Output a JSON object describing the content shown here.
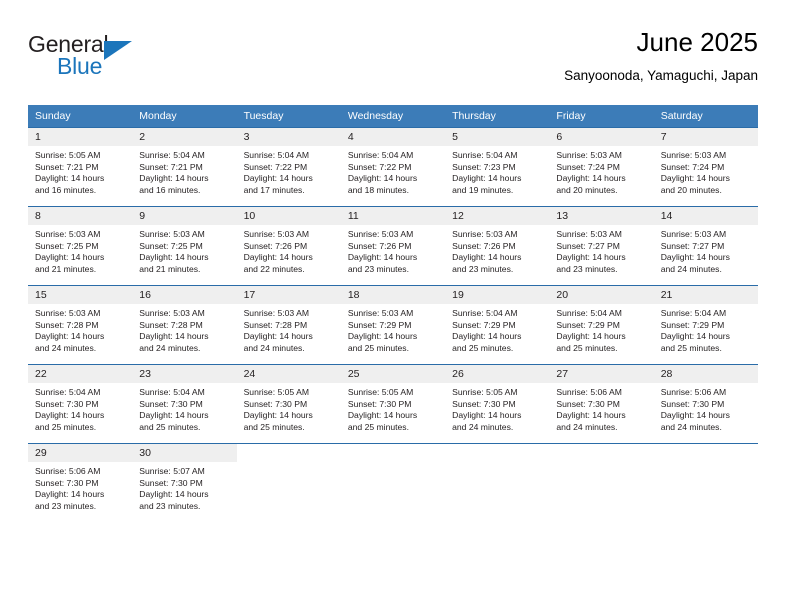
{
  "brand": {
    "name_top": "General",
    "name_bottom": "Blue",
    "color_dark": "#231f20",
    "color_blue": "#1b75bb",
    "triangle_icon": "triangle-icon"
  },
  "header": {
    "title": "June 2025",
    "subtitle": "Sanyoonoda, Yamaguchi, Japan"
  },
  "theme": {
    "header_bg": "#3c7cb8",
    "row_divider": "#2a6ca8",
    "daynum_bg": "#efefef"
  },
  "weekday_headers": [
    "Sunday",
    "Monday",
    "Tuesday",
    "Wednesday",
    "Thursday",
    "Friday",
    "Saturday"
  ],
  "weeks": [
    [
      {
        "day": "1",
        "sunrise": "Sunrise: 5:05 AM",
        "sunset": "Sunset: 7:21 PM",
        "daylight1": "Daylight: 14 hours",
        "daylight2": "and 16 minutes."
      },
      {
        "day": "2",
        "sunrise": "Sunrise: 5:04 AM",
        "sunset": "Sunset: 7:21 PM",
        "daylight1": "Daylight: 14 hours",
        "daylight2": "and 16 minutes."
      },
      {
        "day": "3",
        "sunrise": "Sunrise: 5:04 AM",
        "sunset": "Sunset: 7:22 PM",
        "daylight1": "Daylight: 14 hours",
        "daylight2": "and 17 minutes."
      },
      {
        "day": "4",
        "sunrise": "Sunrise: 5:04 AM",
        "sunset": "Sunset: 7:22 PM",
        "daylight1": "Daylight: 14 hours",
        "daylight2": "and 18 minutes."
      },
      {
        "day": "5",
        "sunrise": "Sunrise: 5:04 AM",
        "sunset": "Sunset: 7:23 PM",
        "daylight1": "Daylight: 14 hours",
        "daylight2": "and 19 minutes."
      },
      {
        "day": "6",
        "sunrise": "Sunrise: 5:03 AM",
        "sunset": "Sunset: 7:24 PM",
        "daylight1": "Daylight: 14 hours",
        "daylight2": "and 20 minutes."
      },
      {
        "day": "7",
        "sunrise": "Sunrise: 5:03 AM",
        "sunset": "Sunset: 7:24 PM",
        "daylight1": "Daylight: 14 hours",
        "daylight2": "and 20 minutes."
      }
    ],
    [
      {
        "day": "8",
        "sunrise": "Sunrise: 5:03 AM",
        "sunset": "Sunset: 7:25 PM",
        "daylight1": "Daylight: 14 hours",
        "daylight2": "and 21 minutes."
      },
      {
        "day": "9",
        "sunrise": "Sunrise: 5:03 AM",
        "sunset": "Sunset: 7:25 PM",
        "daylight1": "Daylight: 14 hours",
        "daylight2": "and 21 minutes."
      },
      {
        "day": "10",
        "sunrise": "Sunrise: 5:03 AM",
        "sunset": "Sunset: 7:26 PM",
        "daylight1": "Daylight: 14 hours",
        "daylight2": "and 22 minutes."
      },
      {
        "day": "11",
        "sunrise": "Sunrise: 5:03 AM",
        "sunset": "Sunset: 7:26 PM",
        "daylight1": "Daylight: 14 hours",
        "daylight2": "and 23 minutes."
      },
      {
        "day": "12",
        "sunrise": "Sunrise: 5:03 AM",
        "sunset": "Sunset: 7:26 PM",
        "daylight1": "Daylight: 14 hours",
        "daylight2": "and 23 minutes."
      },
      {
        "day": "13",
        "sunrise": "Sunrise: 5:03 AM",
        "sunset": "Sunset: 7:27 PM",
        "daylight1": "Daylight: 14 hours",
        "daylight2": "and 23 minutes."
      },
      {
        "day": "14",
        "sunrise": "Sunrise: 5:03 AM",
        "sunset": "Sunset: 7:27 PM",
        "daylight1": "Daylight: 14 hours",
        "daylight2": "and 24 minutes."
      }
    ],
    [
      {
        "day": "15",
        "sunrise": "Sunrise: 5:03 AM",
        "sunset": "Sunset: 7:28 PM",
        "daylight1": "Daylight: 14 hours",
        "daylight2": "and 24 minutes."
      },
      {
        "day": "16",
        "sunrise": "Sunrise: 5:03 AM",
        "sunset": "Sunset: 7:28 PM",
        "daylight1": "Daylight: 14 hours",
        "daylight2": "and 24 minutes."
      },
      {
        "day": "17",
        "sunrise": "Sunrise: 5:03 AM",
        "sunset": "Sunset: 7:28 PM",
        "daylight1": "Daylight: 14 hours",
        "daylight2": "and 24 minutes."
      },
      {
        "day": "18",
        "sunrise": "Sunrise: 5:03 AM",
        "sunset": "Sunset: 7:29 PM",
        "daylight1": "Daylight: 14 hours",
        "daylight2": "and 25 minutes."
      },
      {
        "day": "19",
        "sunrise": "Sunrise: 5:04 AM",
        "sunset": "Sunset: 7:29 PM",
        "daylight1": "Daylight: 14 hours",
        "daylight2": "and 25 minutes."
      },
      {
        "day": "20",
        "sunrise": "Sunrise: 5:04 AM",
        "sunset": "Sunset: 7:29 PM",
        "daylight1": "Daylight: 14 hours",
        "daylight2": "and 25 minutes."
      },
      {
        "day": "21",
        "sunrise": "Sunrise: 5:04 AM",
        "sunset": "Sunset: 7:29 PM",
        "daylight1": "Daylight: 14 hours",
        "daylight2": "and 25 minutes."
      }
    ],
    [
      {
        "day": "22",
        "sunrise": "Sunrise: 5:04 AM",
        "sunset": "Sunset: 7:30 PM",
        "daylight1": "Daylight: 14 hours",
        "daylight2": "and 25 minutes."
      },
      {
        "day": "23",
        "sunrise": "Sunrise: 5:04 AM",
        "sunset": "Sunset: 7:30 PM",
        "daylight1": "Daylight: 14 hours",
        "daylight2": "and 25 minutes."
      },
      {
        "day": "24",
        "sunrise": "Sunrise: 5:05 AM",
        "sunset": "Sunset: 7:30 PM",
        "daylight1": "Daylight: 14 hours",
        "daylight2": "and 25 minutes."
      },
      {
        "day": "25",
        "sunrise": "Sunrise: 5:05 AM",
        "sunset": "Sunset: 7:30 PM",
        "daylight1": "Daylight: 14 hours",
        "daylight2": "and 25 minutes."
      },
      {
        "day": "26",
        "sunrise": "Sunrise: 5:05 AM",
        "sunset": "Sunset: 7:30 PM",
        "daylight1": "Daylight: 14 hours",
        "daylight2": "and 24 minutes."
      },
      {
        "day": "27",
        "sunrise": "Sunrise: 5:06 AM",
        "sunset": "Sunset: 7:30 PM",
        "daylight1": "Daylight: 14 hours",
        "daylight2": "and 24 minutes."
      },
      {
        "day": "28",
        "sunrise": "Sunrise: 5:06 AM",
        "sunset": "Sunset: 7:30 PM",
        "daylight1": "Daylight: 14 hours",
        "daylight2": "and 24 minutes."
      }
    ],
    [
      {
        "day": "29",
        "sunrise": "Sunrise: 5:06 AM",
        "sunset": "Sunset: 7:30 PM",
        "daylight1": "Daylight: 14 hours",
        "daylight2": "and 23 minutes."
      },
      {
        "day": "30",
        "sunrise": "Sunrise: 5:07 AM",
        "sunset": "Sunset: 7:30 PM",
        "daylight1": "Daylight: 14 hours",
        "daylight2": "and 23 minutes."
      },
      {
        "day": "",
        "sunrise": "",
        "sunset": "",
        "daylight1": "",
        "daylight2": ""
      },
      {
        "day": "",
        "sunrise": "",
        "sunset": "",
        "daylight1": "",
        "daylight2": ""
      },
      {
        "day": "",
        "sunrise": "",
        "sunset": "",
        "daylight1": "",
        "daylight2": ""
      },
      {
        "day": "",
        "sunrise": "",
        "sunset": "",
        "daylight1": "",
        "daylight2": ""
      },
      {
        "day": "",
        "sunrise": "",
        "sunset": "",
        "daylight1": "",
        "daylight2": ""
      }
    ]
  ]
}
